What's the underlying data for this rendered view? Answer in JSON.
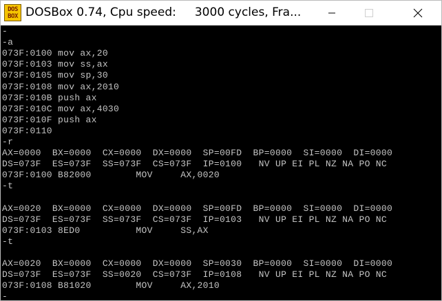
{
  "window": {
    "title": "DOSBox 0.74, Cpu speed:     3000 cycles, Fra...",
    "icon_text": "DOS\nBOX",
    "controls": {
      "minimize": "minimize-icon",
      "maximize": "maximize-icon",
      "close": "close-icon"
    }
  },
  "console": {
    "lines": [
      "-",
      "-a",
      "073F:0100 mov ax,20",
      "073F:0103 mov ss,ax",
      "073F:0105 mov sp,30",
      "073F:0108 mov ax,2010",
      "073F:010B push ax",
      "073F:010C mov ax,4030",
      "073F:010F push ax",
      "073F:0110",
      "-r",
      "AX=0000  BX=0000  CX=0000  DX=0000  SP=00FD  BP=0000  SI=0000  DI=0000",
      "DS=073F  ES=073F  SS=073F  CS=073F  IP=0100   NV UP EI PL NZ NA PO NC",
      "073F:0100 B82000        MOV     AX,0020",
      "-t",
      "",
      "AX=0020  BX=0000  CX=0000  DX=0000  SP=00FD  BP=0000  SI=0000  DI=0000",
      "DS=073F  ES=073F  SS=073F  CS=073F  IP=0103   NV UP EI PL NZ NA PO NC",
      "073F:0103 8ED0          MOV     SS,AX",
      "-t",
      "",
      "AX=0020  BX=0000  CX=0000  DX=0000  SP=0030  BP=0000  SI=0000  DI=0000",
      "DS=073F  ES=073F  SS=0020  CS=073F  IP=0108   NV UP EI PL NZ NA PO NC",
      "073F:0108 B81020        MOV     AX,2010",
      "-"
    ]
  },
  "colors": {
    "console_bg": "#000000",
    "console_fg": "#c4c4c4",
    "titlebar_bg": "#ffffff"
  }
}
